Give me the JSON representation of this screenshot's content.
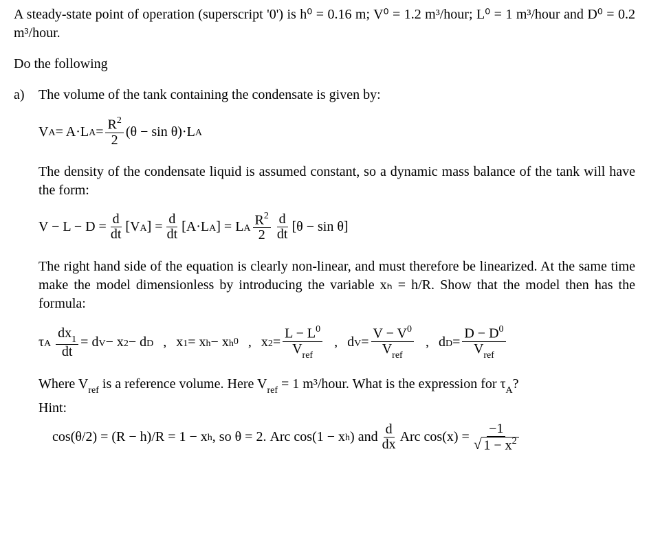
{
  "intro": {
    "text": "A steady-state point of operation (superscript '0') is h⁰ = 0.16 m; V⁰ = 1.2 m³/hour; L⁰ = 1 m³/hour and D⁰ = 0.2 m³/hour."
  },
  "prompt": "Do the following",
  "partA": {
    "marker": "a)",
    "lead": "The volume of the tank containing the condensate is given by:",
    "eq1": {
      "lhs": "V",
      "sym_A": "A",
      "eq": " = A·L",
      "sym_LA": "A",
      "eq2": " = ",
      "Rnum": "R",
      "Rexp": "2",
      "Rden": "2",
      "paren": "(θ − sin θ)·L",
      "sym_LA2": "A"
    },
    "density_text": "The density of the condensate liquid is assumed constant, so a dynamic mass balance of the tank will have the form:",
    "eq2": {
      "left": "V − L − D = ",
      "d": "d",
      "dt": "dt",
      "VA_open": "[V",
      "VA_sub": "A",
      "VA_close": "] = ",
      "ALA_open": "[A·L",
      "ALA_sub": "A",
      "ALA_close": "] = L",
      "LA_sub": "A",
      "Rnum": "R",
      "Rexp": "2",
      "Rden": "2",
      "brack": "[θ − sin θ]"
    },
    "nonlin_text": "The right hand side of the equation is clearly non-linear, and must therefore be linearized. At the same time make the model dimensionless by introducing the variable xₕ = h/R. Show that the model then has the formula:",
    "defs": {
      "tauA": "τ",
      "tauA_sub": "A",
      "dx1_num": "dx",
      "dx1_sub": "1",
      "dt": "dt",
      "rhs1": " = d",
      "dV_sub": "V",
      "rhs1b": " − x",
      "x2_sub": "2",
      "rhs1c": " − d",
      "dD_sub": "D",
      "sep": ",",
      "x1": "x",
      "x1_sub": "1",
      "x1_eq": " = x",
      "xh_sub": "h",
      "x1_minus": " − x",
      "xh0_sub": "h",
      "xh0_sup": "0",
      "x2": "x",
      "x2b_sub": "2",
      "x2_eq": " = ",
      "LL0_num_a": "L − L",
      "LL0_sup": "0",
      "Vref": "V",
      "Vref_sub": "ref",
      "dV": "d",
      "dVb_sub": "V",
      "dV_eq": " = ",
      "VV0_num_a": "V − V",
      "VV0_sup": "0",
      "dD": "d",
      "dDb_sub": "D",
      "dD_eq": " = ",
      "DD0_num_a": "D − D",
      "DD0_sup": "0"
    },
    "where_text": "Where Vref is a reference volume. Here Vref = 1 m³/hour. What is the expression for τA?",
    "hint_label": "Hint:",
    "hint": {
      "cos": "cos(θ/2) = (R − h)/R = 1 − x",
      "xh_sub": "h",
      "so": ", so θ = 2. Arc cos(1 − x",
      "xh_sub2": "h",
      "close": ")  and  ",
      "d": "d",
      "dx": "dx",
      "arccos": "Arc cos(x) = ",
      "neg1": "−1",
      "one_minus_x2_a": "1 − x",
      "one_minus_x2_exp": "2"
    }
  }
}
